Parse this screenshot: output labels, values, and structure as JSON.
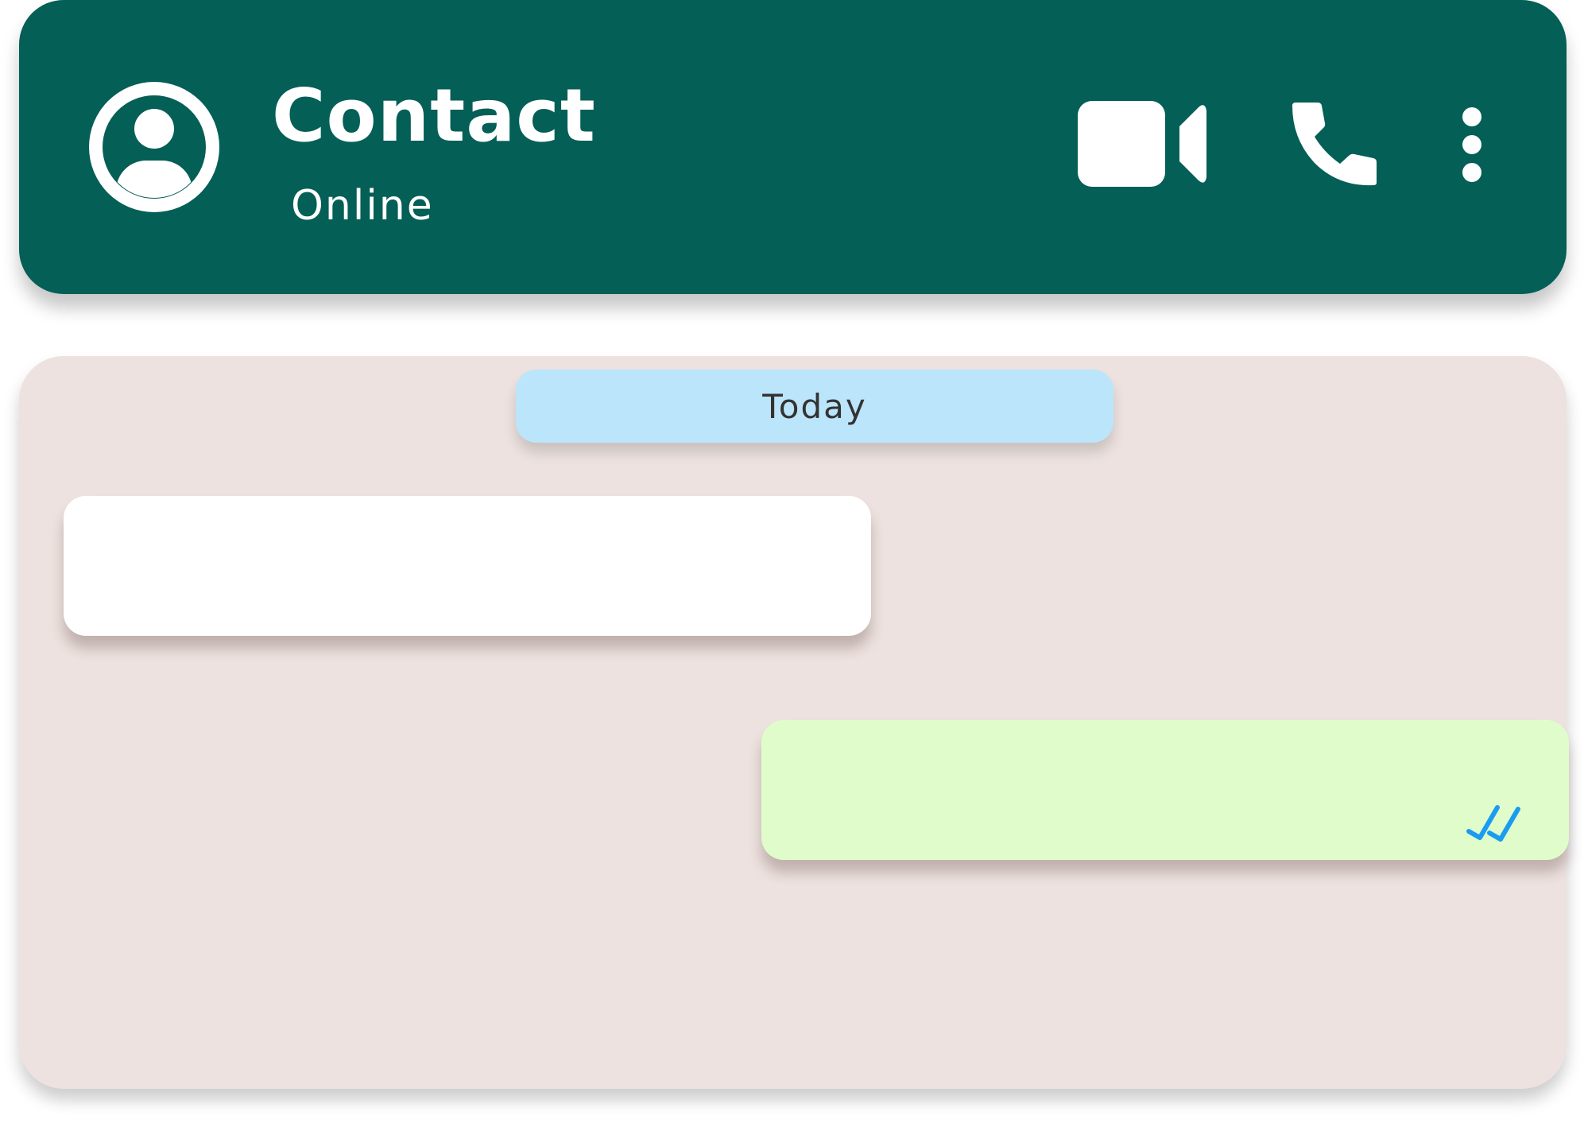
{
  "header": {
    "contact_name": "Contact",
    "status": "Online",
    "background_color": "#045f56",
    "icons": {
      "avatar": "user-avatar-icon",
      "video_call": "video-camera-icon",
      "voice_call": "phone-icon",
      "menu": "more-vertical-icon"
    }
  },
  "chat": {
    "background_color": "#ede2df",
    "date_separator": "Today",
    "messages": [
      {
        "direction": "incoming",
        "text": "",
        "color": "#ffffff"
      },
      {
        "direction": "outgoing",
        "text": "",
        "color": "#e0fccb",
        "status_icon": "double-check-icon",
        "status_color": "#1a9cf0"
      }
    ]
  }
}
